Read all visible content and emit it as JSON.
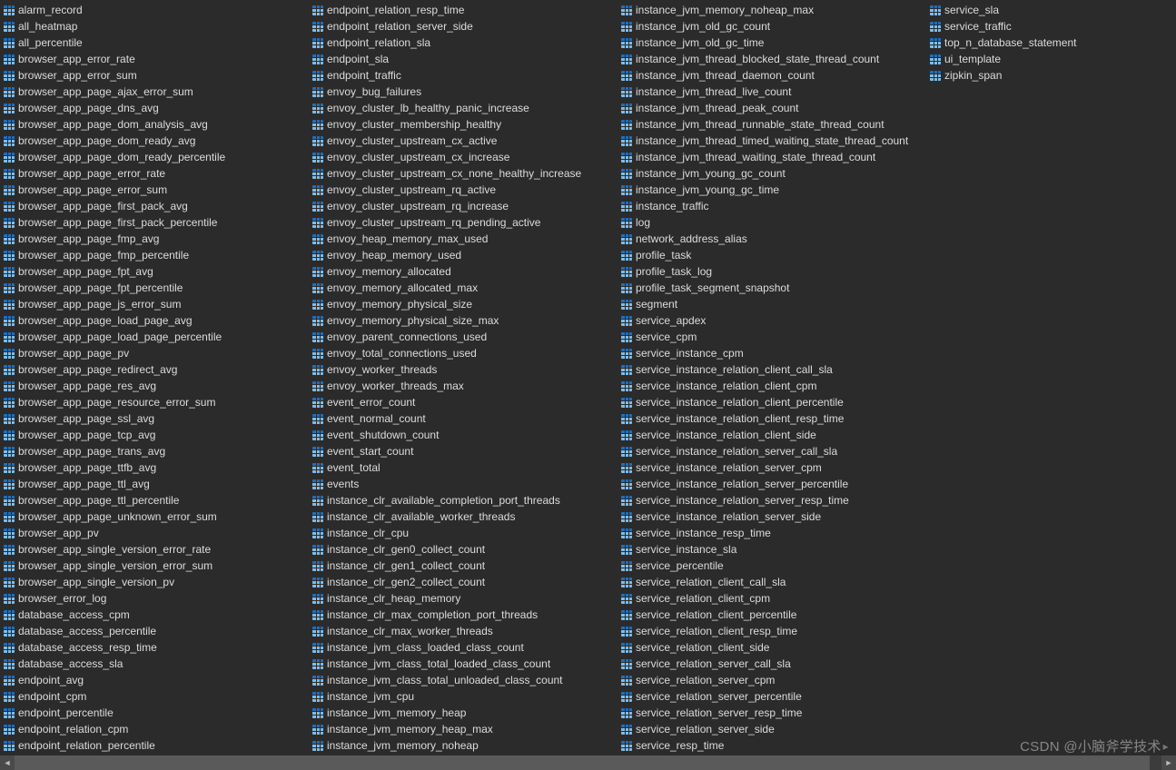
{
  "watermark": "CSDN @小脑斧学技术",
  "columns": [
    [
      "alarm_record",
      "all_heatmap",
      "all_percentile",
      "browser_app_error_rate",
      "browser_app_error_sum",
      "browser_app_page_ajax_error_sum",
      "browser_app_page_dns_avg",
      "browser_app_page_dom_analysis_avg",
      "browser_app_page_dom_ready_avg",
      "browser_app_page_dom_ready_percentile",
      "browser_app_page_error_rate",
      "browser_app_page_error_sum",
      "browser_app_page_first_pack_avg",
      "browser_app_page_first_pack_percentile",
      "browser_app_page_fmp_avg",
      "browser_app_page_fmp_percentile",
      "browser_app_page_fpt_avg",
      "browser_app_page_fpt_percentile",
      "browser_app_page_js_error_sum",
      "browser_app_page_load_page_avg",
      "browser_app_page_load_page_percentile",
      "browser_app_page_pv",
      "browser_app_page_redirect_avg",
      "browser_app_page_res_avg",
      "browser_app_page_resource_error_sum",
      "browser_app_page_ssl_avg",
      "browser_app_page_tcp_avg",
      "browser_app_page_trans_avg",
      "browser_app_page_ttfb_avg",
      "browser_app_page_ttl_avg",
      "browser_app_page_ttl_percentile",
      "browser_app_page_unknown_error_sum",
      "browser_app_pv",
      "browser_app_single_version_error_rate",
      "browser_app_single_version_error_sum",
      "browser_app_single_version_pv",
      "browser_error_log",
      "database_access_cpm",
      "database_access_percentile",
      "database_access_resp_time",
      "database_access_sla",
      "endpoint_avg",
      "endpoint_cpm",
      "endpoint_percentile",
      "endpoint_relation_cpm",
      "endpoint_relation_percentile"
    ],
    [
      "endpoint_relation_resp_time",
      "endpoint_relation_server_side",
      "endpoint_relation_sla",
      "endpoint_sla",
      "endpoint_traffic",
      "envoy_bug_failures",
      "envoy_cluster_lb_healthy_panic_increase",
      "envoy_cluster_membership_healthy",
      "envoy_cluster_upstream_cx_active",
      "envoy_cluster_upstream_cx_increase",
      "envoy_cluster_upstream_cx_none_healthy_increase",
      "envoy_cluster_upstream_rq_active",
      "envoy_cluster_upstream_rq_increase",
      "envoy_cluster_upstream_rq_pending_active",
      "envoy_heap_memory_max_used",
      "envoy_heap_memory_used",
      "envoy_memory_allocated",
      "envoy_memory_allocated_max",
      "envoy_memory_physical_size",
      "envoy_memory_physical_size_max",
      "envoy_parent_connections_used",
      "envoy_total_connections_used",
      "envoy_worker_threads",
      "envoy_worker_threads_max",
      "event_error_count",
      "event_normal_count",
      "event_shutdown_count",
      "event_start_count",
      "event_total",
      "events",
      "instance_clr_available_completion_port_threads",
      "instance_clr_available_worker_threads",
      "instance_clr_cpu",
      "instance_clr_gen0_collect_count",
      "instance_clr_gen1_collect_count",
      "instance_clr_gen2_collect_count",
      "instance_clr_heap_memory",
      "instance_clr_max_completion_port_threads",
      "instance_clr_max_worker_threads",
      "instance_jvm_class_loaded_class_count",
      "instance_jvm_class_total_loaded_class_count",
      "instance_jvm_class_total_unloaded_class_count",
      "instance_jvm_cpu",
      "instance_jvm_memory_heap",
      "instance_jvm_memory_heap_max",
      "instance_jvm_memory_noheap"
    ],
    [
      "instance_jvm_memory_noheap_max",
      "instance_jvm_old_gc_count",
      "instance_jvm_old_gc_time",
      "instance_jvm_thread_blocked_state_thread_count",
      "instance_jvm_thread_daemon_count",
      "instance_jvm_thread_live_count",
      "instance_jvm_thread_peak_count",
      "instance_jvm_thread_runnable_state_thread_count",
      "instance_jvm_thread_timed_waiting_state_thread_count",
      "instance_jvm_thread_waiting_state_thread_count",
      "instance_jvm_young_gc_count",
      "instance_jvm_young_gc_time",
      "instance_traffic",
      "log",
      "network_address_alias",
      "profile_task",
      "profile_task_log",
      "profile_task_segment_snapshot",
      "segment",
      "service_apdex",
      "service_cpm",
      "service_instance_cpm",
      "service_instance_relation_client_call_sla",
      "service_instance_relation_client_cpm",
      "service_instance_relation_client_percentile",
      "service_instance_relation_client_resp_time",
      "service_instance_relation_client_side",
      "service_instance_relation_server_call_sla",
      "service_instance_relation_server_cpm",
      "service_instance_relation_server_percentile",
      "service_instance_relation_server_resp_time",
      "service_instance_relation_server_side",
      "service_instance_resp_time",
      "service_instance_sla",
      "service_percentile",
      "service_relation_client_call_sla",
      "service_relation_client_cpm",
      "service_relation_client_percentile",
      "service_relation_client_resp_time",
      "service_relation_client_side",
      "service_relation_server_call_sla",
      "service_relation_server_cpm",
      "service_relation_server_percentile",
      "service_relation_server_resp_time",
      "service_relation_server_side",
      "service_resp_time"
    ],
    [
      "service_sla",
      "service_traffic",
      "top_n_database_statement",
      "ui_template",
      "zipkin_span"
    ]
  ]
}
